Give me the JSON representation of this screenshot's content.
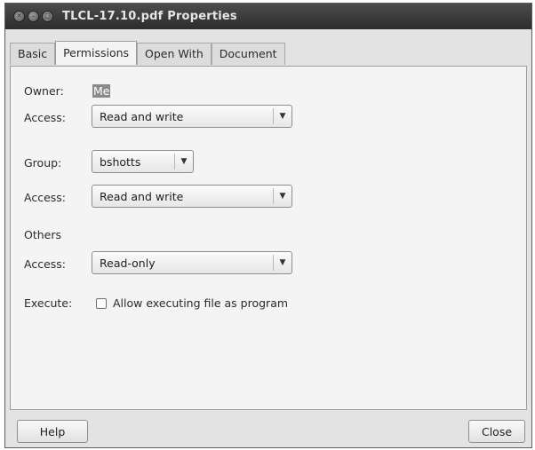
{
  "window": {
    "title": "TLCL-17.10.pdf Properties"
  },
  "tabs": [
    {
      "label": "Basic"
    },
    {
      "label": "Permissions"
    },
    {
      "label": "Open With"
    },
    {
      "label": "Document"
    }
  ],
  "active_tab": "Permissions",
  "permissions": {
    "owner_label": "Owner:",
    "owner_value": "Me",
    "owner_access_label": "Access:",
    "owner_access_value": "Read and write",
    "group_label": "Group:",
    "group_value": "bshotts",
    "group_access_label": "Access:",
    "group_access_value": "Read and write",
    "others_label": "Others",
    "others_access_label": "Access:",
    "others_access_value": "Read-only",
    "execute_label": "Execute:",
    "execute_checkbox_label": "Allow executing file as program",
    "execute_checked": false
  },
  "buttons": {
    "help": "Help",
    "close": "Close"
  },
  "icons": {
    "close": "close-icon",
    "minimize": "minimize-icon",
    "maximize": "maximize-icon",
    "dropdown": "chevron-down-icon"
  }
}
